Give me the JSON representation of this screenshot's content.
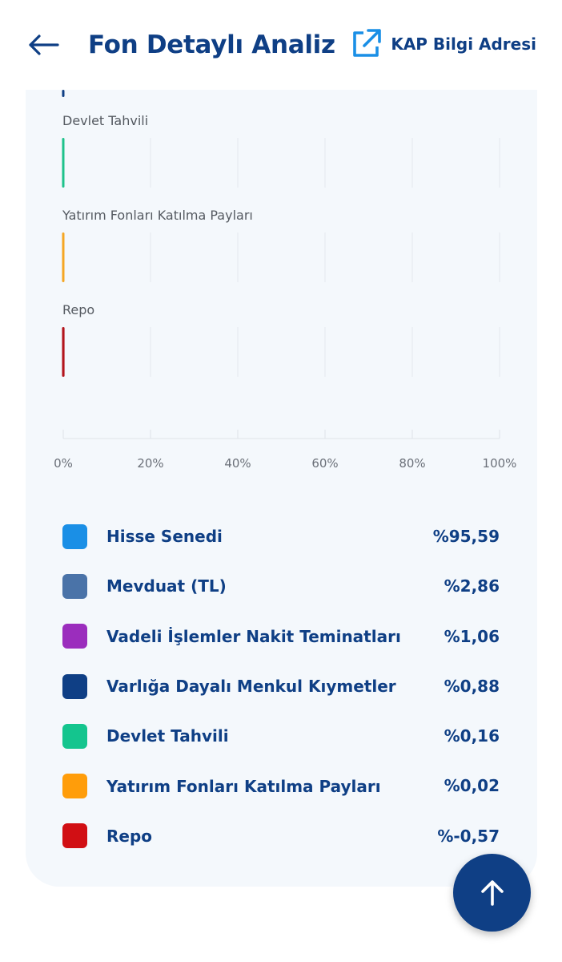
{
  "header": {
    "back_icon": "arrow-left-icon",
    "title": "Fon Detaylı Analiz",
    "kap_icon": "external-link-icon",
    "kap_label": "KAP Bilgi Adresi"
  },
  "chart_data": {
    "type": "bar",
    "orientation": "horizontal",
    "xlim": [
      0,
      100
    ],
    "x_ticks": [
      "0%",
      "20%",
      "40%",
      "60%",
      "80%",
      "100%"
    ],
    "grid": true,
    "categories": [
      "Devlet Tahvili",
      "Yatırım Fonları Katılma Payları",
      "Repo"
    ],
    "values": [
      0.16,
      0.02,
      -0.57
    ],
    "colors": [
      "#1ec28b",
      "#f5a623",
      "#b3141c"
    ]
  },
  "legend": {
    "items": [
      {
        "name": "Hisse Senedi",
        "value": "%95,59",
        "color": "#1a8fe6"
      },
      {
        "name": "Mevduat (TL)",
        "value": "%2,86",
        "color": "#4a73a8"
      },
      {
        "name": "Vadeli İşlemler Nakit Teminatları",
        "value": "%1,06",
        "color": "#9b2dbd"
      },
      {
        "name": "Varlığa Dayalı Menkul Kıymetler",
        "value": "%0,88",
        "color": "#0f3f85"
      },
      {
        "name": "Devlet Tahvili",
        "value": "%0,16",
        "color": "#14c58e"
      },
      {
        "name": "Yatırım Fonları Katılma Payları",
        "value": "%0,02",
        "color": "#ff9d0a"
      },
      {
        "name": "Repo",
        "value": "%-0,57",
        "color": "#d10f14"
      }
    ]
  },
  "fab": {
    "icon": "arrow-up-icon"
  }
}
